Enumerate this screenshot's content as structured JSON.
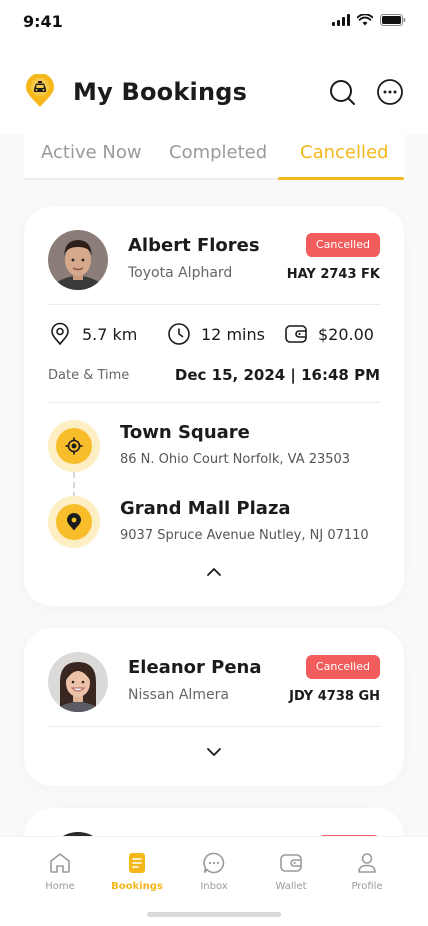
{
  "status_bar": {
    "time": "9:41"
  },
  "header": {
    "title": "My Bookings",
    "accent_color": "#f5b81b"
  },
  "tabs": [
    {
      "label": "Active Now",
      "active": false
    },
    {
      "label": "Completed",
      "active": false
    },
    {
      "label": "Cancelled",
      "active": true
    }
  ],
  "bookings": [
    {
      "driver_name": "Albert Flores",
      "car_model": "Toyota Alphard",
      "status": "Cancelled",
      "plate": "HAY 2743 FK",
      "distance": "5.7 km",
      "duration": "12 mins",
      "price": "$20.00",
      "datetime_label": "Date & Time",
      "datetime_value": "Dec 15, 2024 | 16:48 PM",
      "pickup_name": "Town Square",
      "pickup_address": "86 N. Ohio Court Norfolk, VA 23503",
      "dropoff_name": "Grand Mall Plaza",
      "dropoff_address": "9037 Spruce Avenue Nutley, NJ 07110",
      "expanded": true
    },
    {
      "driver_name": "Eleanor Pena",
      "car_model": "Nissan Almera",
      "status": "Cancelled",
      "plate": "JDY 4738 GH",
      "expanded": false
    }
  ],
  "nav": [
    {
      "label": "Home",
      "icon": "home-icon",
      "active": false
    },
    {
      "label": "Bookings",
      "icon": "bookings-icon",
      "active": true
    },
    {
      "label": "Inbox",
      "icon": "inbox-icon",
      "active": false
    },
    {
      "label": "Wallet",
      "icon": "wallet-icon",
      "active": false
    },
    {
      "label": "Profile",
      "icon": "profile-icon",
      "active": false
    }
  ],
  "colors": {
    "accent": "#f5b81b",
    "cancelled_badge": "#f25c5c",
    "pin_light": "#fdeec3"
  }
}
